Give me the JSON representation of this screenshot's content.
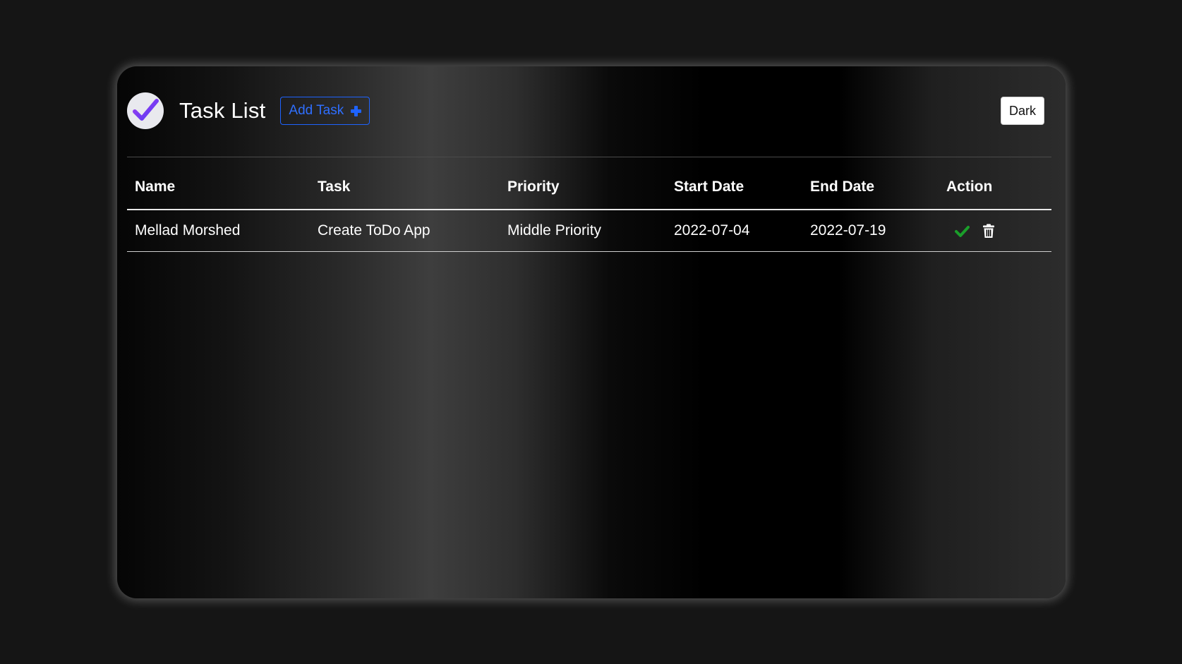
{
  "header": {
    "title": "Task List",
    "add_button_label": "Add Task",
    "theme_button_label": "Dark"
  },
  "table": {
    "columns": [
      "Name",
      "Task",
      "Priority",
      "Start Date",
      "End Date",
      "Action"
    ],
    "rows": [
      {
        "name": "Mellad Morshed",
        "task": "Create ToDo App",
        "priority": "Middle Priority",
        "start_date": "2022-07-04",
        "end_date": "2022-07-19",
        "actions": [
          "check-icon",
          "trash-icon"
        ]
      }
    ]
  },
  "colors": {
    "accent_blue": "#1e63ff",
    "check_green": "#1a9e2a",
    "logo_purple": "#7b3cf5"
  },
  "icons": {
    "logo": "checkmark-logo-icon",
    "add": "plus-icon",
    "complete": "check-icon",
    "delete": "trash-icon"
  }
}
